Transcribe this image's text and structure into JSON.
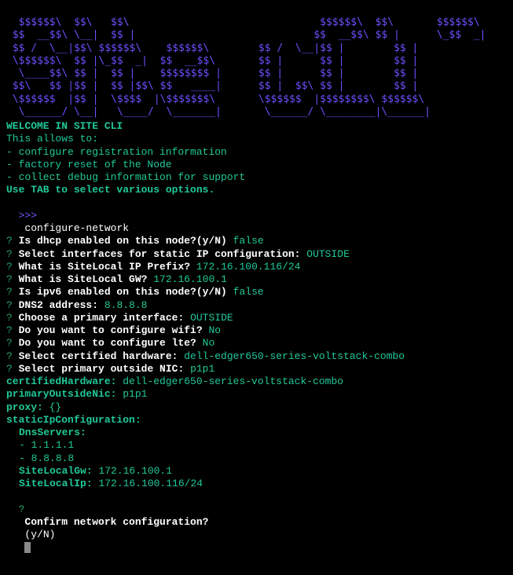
{
  "ascii_art": "  $$$$$$\\  $$\\   $$\\                               $$$$$$\\  $$\\       $$$$$$\\\n $$  __$$\\ \\__|  $$ |                             $$  __$$\\ $$ |      \\_$$  _|\n $$ /  \\__|$$\\ $$$$$$\\    $$$$$$\\        $$ /  \\__|$$ |        $$ |\n \\$$$$$$\\  $$ |\\_$$  _|  $$  __$$\\       $$ |      $$ |        $$ |\n  \\____$$\\ $$ |  $$ |    $$$$$$$$ |      $$ |      $$ |        $$ |\n $$\\   $$ |$$ |  $$ |$$\\ $$   ____|      $$ |  $$\\ $$ |        $$ |\n \\$$$$$$  |$$ |  \\$$$$  |\\$$$$$$$\\       \\$$$$$$  |$$$$$$$$\\ $$$$$$\\\n  \\______/ \\__|   \\____/  \\_______|       \\______/ \\________|\\______|",
  "welcome": "WELCOME IN SITE CLI",
  "intro_header": "This allows to:",
  "intro_items": [
    "- configure registration information",
    "- factory reset of the Node",
    "- collect debug information for support"
  ],
  "tab_line": "Use TAB to select various options.",
  "prompt": ">>>",
  "command": "configure-network",
  "questions": [
    {
      "q": "Is dhcp enabled on this node?(y/N)",
      "a": "false"
    },
    {
      "q": "Select interfaces for static IP configuration:",
      "a": "OUTSIDE"
    },
    {
      "q": "What is SiteLocal IP Prefix?",
      "a": "172.16.100.116/24"
    },
    {
      "q": "What is SiteLocal GW?",
      "a": "172.16.100.1"
    },
    {
      "q": "Is ipv6 enabled on this node?(y/N)",
      "a": "false"
    },
    {
      "q": "DNS2 address:",
      "a": "8.8.8.8"
    },
    {
      "q": "Choose a primary interface:",
      "a": "OUTSIDE"
    },
    {
      "q": "Do you want to configure wifi?",
      "a": "No"
    },
    {
      "q": "Do you want to configure lte?",
      "a": "No"
    },
    {
      "q": "Select certified hardware:",
      "a": "dell-edger650-series-voltstack-combo"
    },
    {
      "q": "Select primary outside NIC:",
      "a": "p1p1"
    }
  ],
  "config_summary": {
    "certifiedHardware": "dell-edger650-series-voltstack-combo",
    "primaryOutsideNic": "p1p1",
    "proxy": "{}",
    "staticIpConfiguration_label": "staticIpConfiguration:",
    "DnsServers_label": "DnsServers:",
    "DnsServers": [
      "1.1.1.1",
      "8.8.8.8"
    ],
    "SiteLocalGw": "172.16.100.1",
    "SiteLocalIp": "172.16.100.116/24"
  },
  "confirm": {
    "q": "Confirm network configuration?",
    "yn": "(y/N)"
  }
}
